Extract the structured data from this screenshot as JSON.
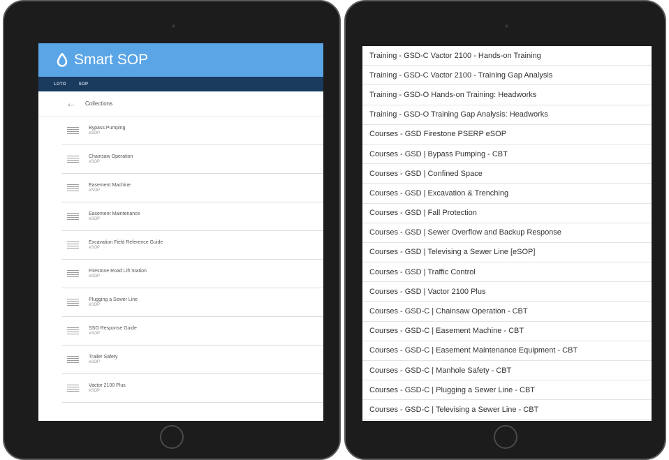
{
  "left": {
    "app_title": "Smart SOP",
    "tabs": [
      "LOTO",
      "SOP"
    ],
    "collections_label": "Collections",
    "items": [
      {
        "title": "Bypass Pumping",
        "subtitle": "eSOP"
      },
      {
        "title": "Chainsaw Operation",
        "subtitle": "eSOP"
      },
      {
        "title": "Easement Machine",
        "subtitle": "eSOP"
      },
      {
        "title": "Easement Maintenance",
        "subtitle": "eSOP"
      },
      {
        "title": "Excavation Field Reference Guide",
        "subtitle": "eSOP"
      },
      {
        "title": "Firestone Road Lift Station",
        "subtitle": "eSOP"
      },
      {
        "title": "Plugging a Sewer Line",
        "subtitle": "eSOP"
      },
      {
        "title": "SSO Response Guide",
        "subtitle": "eSOP"
      },
      {
        "title": "Trailer Safety",
        "subtitle": "eSOP"
      },
      {
        "title": "Vactor 2100 Plus",
        "subtitle": "eSOP"
      }
    ]
  },
  "right": {
    "rows": [
      "Training - GSD-C Vactor 2100 - Hands-on Training",
      "Training - GSD-C Vactor 2100 - Training Gap Analysis",
      "Training - GSD-O Hands-on Training: Headworks",
      "Training - GSD-O Training Gap Analysis: Headworks",
      "Courses - GSD Firestone PSERP eSOP",
      "Courses - GSD | Bypass Pumping - CBT",
      "Courses - GSD | Confined Space",
      "Courses - GSD | Excavation & Trenching",
      "Courses - GSD | Fall Protection",
      "Courses - GSD | Sewer Overflow and Backup Response",
      "Courses - GSD | Televising a Sewer Line [eSOP]",
      "Courses - GSD | Traffic Control",
      "Courses - GSD | Vactor 2100 Plus",
      "Courses - GSD-C | Chainsaw Operation - CBT",
      "Courses - GSD-C | Easement Machine - CBT",
      "Courses - GSD-C | Easement Maintenance Equipment - CBT",
      "Courses - GSD-C | Manhole Safety - CBT",
      "Courses - GSD-C | Plugging a Sewer Line - CBT",
      "Courses - GSD-C | Televising a Sewer Line - CBT"
    ]
  },
  "colors": {
    "header_blue": "#5aa5e6",
    "nav_dark_blue": "#1a3a5e",
    "bezel": "#1c1c1c"
  },
  "icons": [
    "drop-logo-icon",
    "back-arrow-icon",
    "list-icon"
  ]
}
